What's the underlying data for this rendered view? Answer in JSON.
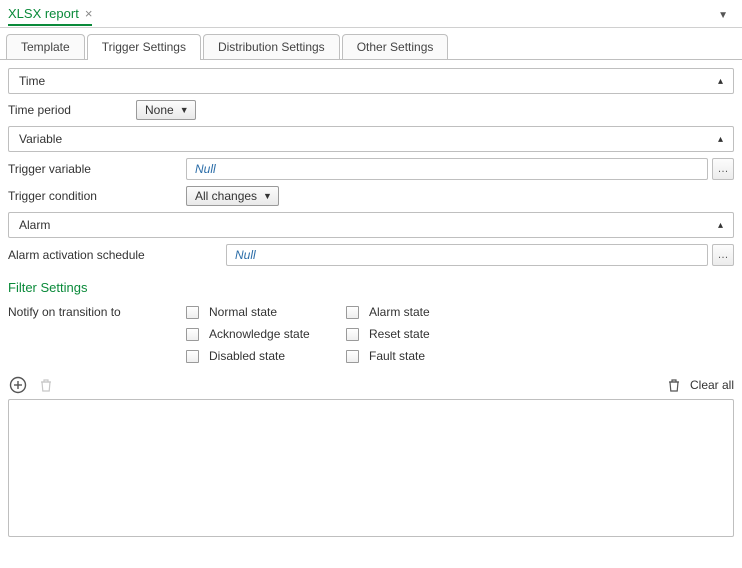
{
  "header": {
    "doc_title": "XLSX report"
  },
  "tabs": [
    "Template",
    "Trigger Settings",
    "Distribution Settings",
    "Other Settings"
  ],
  "active_tab_index": 1,
  "groups": {
    "time": {
      "title": "Time",
      "time_period_label": "Time period",
      "time_period_value": "None"
    },
    "variable": {
      "title": "Variable",
      "trigger_variable_label": "Trigger variable",
      "trigger_variable_value": "Null",
      "trigger_condition_label": "Trigger condition",
      "trigger_condition_value": "All changes"
    },
    "alarm": {
      "title": "Alarm",
      "schedule_label": "Alarm activation schedule",
      "schedule_value": "Null"
    }
  },
  "filter": {
    "title": "Filter Settings",
    "notify_label": "Notify on transition to",
    "options": {
      "normal": "Normal state",
      "alarm": "Alarm state",
      "acknowledge": "Acknowledge state",
      "reset": "Reset state",
      "disabled": "Disabled state",
      "fault": "Fault state"
    }
  },
  "toolbar": {
    "clear_all": "Clear all"
  },
  "browse": "…"
}
